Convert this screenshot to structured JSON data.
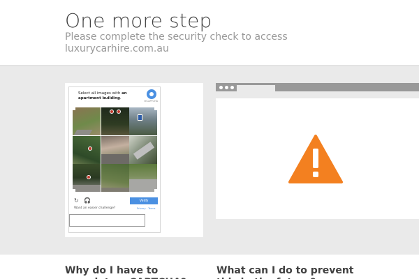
{
  "header": {
    "title": "One more step",
    "subtitle": "Please complete the security check to access luxurycarhire.com.au"
  },
  "captcha": {
    "prompt_prefix": "Select all images with",
    "prompt_emphasis": "an apartment building",
    "prompt_suffix": ".",
    "brand_label": "reCAPTCHA",
    "tiles": [
      {
        "label": "captcha-tile"
      },
      {
        "label": "captcha-tile"
      },
      {
        "label": "captcha-tile"
      },
      {
        "label": "captcha-tile"
      },
      {
        "label": "captcha-tile"
      },
      {
        "label": "captcha-tile"
      },
      {
        "label": "captcha-tile"
      },
      {
        "label": "captcha-tile"
      },
      {
        "label": "captcha-tile"
      }
    ],
    "reload_icon": "reload-icon",
    "audio_icon": "headphones-icon",
    "verify_label": "Verify",
    "easier_label": "Want an easier challenge?",
    "privacy_label": "Privacy - Terms",
    "response_value": ""
  },
  "browser_illustration": {
    "icon": "warning-icon",
    "accent": "#f38020"
  },
  "faq": {
    "left_question": "Why do I have to complete a CAPTCHA?",
    "right_question": "What can I do to prevent this in the future?"
  },
  "colors": {
    "band": "#eaeaea",
    "verify": "#4a90e2",
    "warning": "#f38020"
  }
}
